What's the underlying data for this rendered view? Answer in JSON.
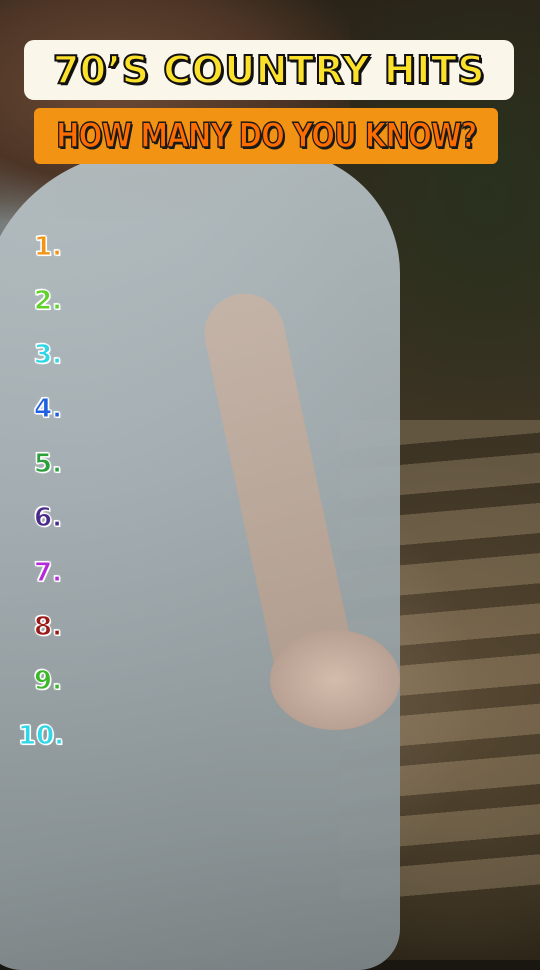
{
  "header": {
    "title": "70’S COUNTRY HITS",
    "subtitle": "HOW MANY DO YOU KNOW?"
  },
  "list": {
    "items": [
      {
        "label": "1.",
        "color": "#f39313"
      },
      {
        "label": "2.",
        "color": "#5fd12a"
      },
      {
        "label": "3.",
        "color": "#2fd6e6"
      },
      {
        "label": "4.",
        "color": "#1f5fe0"
      },
      {
        "label": "5.",
        "color": "#2aa03a"
      },
      {
        "label": "6.",
        "color": "#4a2a8a"
      },
      {
        "label": "7.",
        "color": "#b42ad8"
      },
      {
        "label": "8.",
        "color": "#9a1a1a"
      },
      {
        "label": "9.",
        "color": "#3ab82a"
      },
      {
        "label": "10.",
        "color": "#2fd6e6"
      }
    ]
  }
}
